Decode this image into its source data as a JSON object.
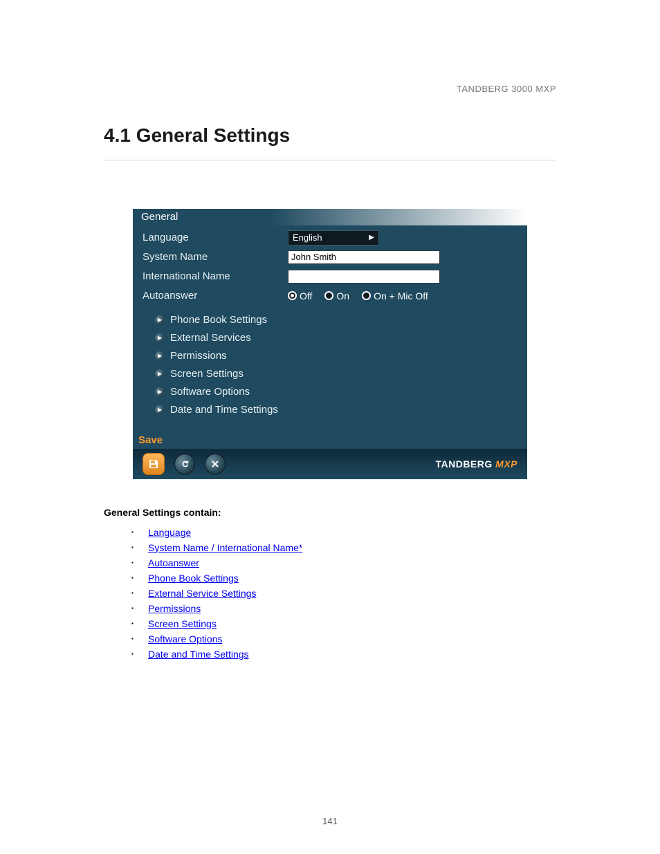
{
  "header": {
    "product": "TANDBERG 3000 MXP"
  },
  "section_title": "4.1 General Settings",
  "panel": {
    "title": "General",
    "fields": {
      "language": {
        "label": "Language",
        "value": "English"
      },
      "system_name": {
        "label": "System Name",
        "value": "John Smith"
      },
      "international_name": {
        "label": "International Name",
        "value": ""
      },
      "autoanswer": {
        "label": "Autoanswer",
        "options": [
          "Off",
          "On",
          "On + Mic Off"
        ],
        "selected": "Off"
      }
    },
    "nav_items": [
      "Phone Book Settings",
      "External Services",
      "Permissions",
      "Screen Settings",
      "Software Options",
      "Date and Time Settings"
    ],
    "save_label": "Save",
    "brand": {
      "name": "TANDBERG",
      "suffix": "MXP"
    }
  },
  "intro": "General Settings contain:",
  "links": [
    "Language",
    "System Name / International Name*",
    "Autoanswer",
    "Phone Book Settings",
    "External Service Settings",
    "Permissions",
    "Screen Settings",
    "Software Options",
    "Date and Time Settings"
  ],
  "page_number": "141"
}
